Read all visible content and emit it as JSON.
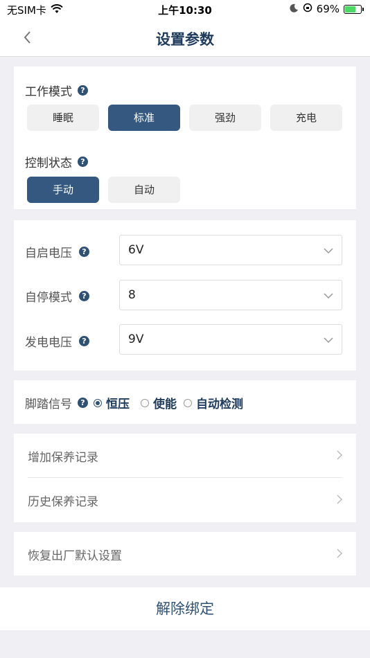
{
  "status_bar": {
    "carrier": "无SIM卡",
    "time": "上午10:30",
    "battery": "69%",
    "icons": [
      "wifi-icon",
      "moon-icon",
      "orientation-lock-icon",
      "battery-icon"
    ]
  },
  "nav": {
    "title": "设置参数",
    "back_icon": "chevron-left-icon"
  },
  "work_mode": {
    "label": "工作模式",
    "options": [
      "睡眠",
      "标准",
      "强劲",
      "充电"
    ],
    "selected": "标准"
  },
  "control_state": {
    "label": "控制状态",
    "options": [
      "手动",
      "自动"
    ],
    "selected": "手动"
  },
  "params": [
    {
      "label": "自启电压",
      "value": "6V"
    },
    {
      "label": "自停模式",
      "value": "8"
    },
    {
      "label": "发电电压",
      "value": "9V"
    }
  ],
  "pedal_signal": {
    "label": "脚踏信号",
    "options": [
      "恒压",
      "使能",
      "自动检测"
    ],
    "selected": "恒压"
  },
  "maintenance": {
    "add": "增加保养记录",
    "history": "历史保养记录"
  },
  "factory_reset": "恢复出厂默认设置",
  "unbind": "解除绑定",
  "colors": {
    "accent": "#34587f",
    "title": "#1f3b5c",
    "background": "#f0f0f4"
  }
}
